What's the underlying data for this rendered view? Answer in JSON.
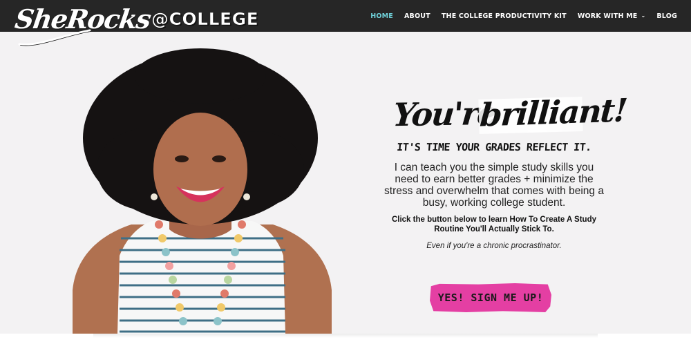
{
  "header": {
    "logo_script": "SheRocks",
    "logo_tail": "@COLLEGE",
    "nav": [
      {
        "label": "HOME",
        "active": true
      },
      {
        "label": "ABOUT",
        "active": false
      },
      {
        "label": "THE COLLEGE PRODUCTIVITY KIT",
        "active": false
      },
      {
        "label": "WORK WITH ME",
        "active": false,
        "has_dropdown": true
      },
      {
        "label": "BLOG",
        "active": false
      }
    ]
  },
  "hero": {
    "headline_part1": "You're",
    "headline_part2": "brilliant!",
    "subhead": "IT'S TIME YOUR GRADES REFLECT IT.",
    "body": "I can teach you the simple study skills you need to earn better grades + minimize the stress and overwhelm that comes with being a busy, working college student.",
    "cta_lead": "Click the button below to learn How To Create A Study Routine You'll Actually Stick To.",
    "cta_note": "Even if you're a chronic procrastinator.",
    "cta_button": "YES! SIGN ME UP!"
  },
  "colors": {
    "header_bg": "#262626",
    "nav_active": "#6fd0d8",
    "hero_bg": "#f3f2f3",
    "cta_bg": "#e43fa3"
  }
}
